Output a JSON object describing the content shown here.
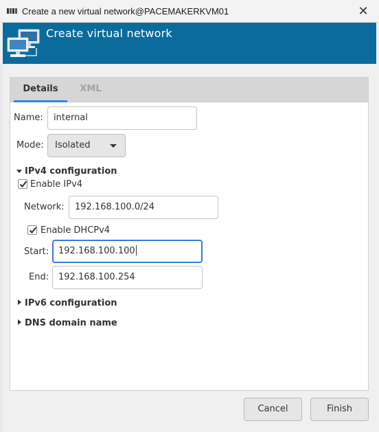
{
  "window": {
    "title": "Create a new virtual network@PACEMAKERKVM01",
    "close_glyph": "✕"
  },
  "header": {
    "title": "Create virtual network",
    "icon": "network-icon"
  },
  "tabs": [
    {
      "label": "Details",
      "active": true
    },
    {
      "label": "XML",
      "active": false
    }
  ],
  "form": {
    "name_label": "Name:",
    "name_value": "internal",
    "mode_label": "Mode:",
    "mode_value": "Isolated",
    "ipv4": {
      "header": "IPv4 configuration",
      "expanded": true,
      "enable_label": "Enable IPv4",
      "enable_checked": true,
      "network_label": "Network:",
      "network_value": "192.168.100.0/24",
      "dhcp_label": "Enable DHCPv4",
      "dhcp_checked": true,
      "start_label": "Start:",
      "start_value": "192.168.100.100",
      "end_label": "End:",
      "end_value": "192.168.100.254"
    },
    "ipv6": {
      "header": "IPv6 configuration",
      "expanded": false
    },
    "dns": {
      "header": "DNS domain name",
      "expanded": false
    }
  },
  "buttons": {
    "cancel": "Cancel",
    "finish": "Finish"
  },
  "colors": {
    "header_bg": "#0b6b9c",
    "focus": "#3a7bd5",
    "active_tab_underline": "#3584e4"
  }
}
